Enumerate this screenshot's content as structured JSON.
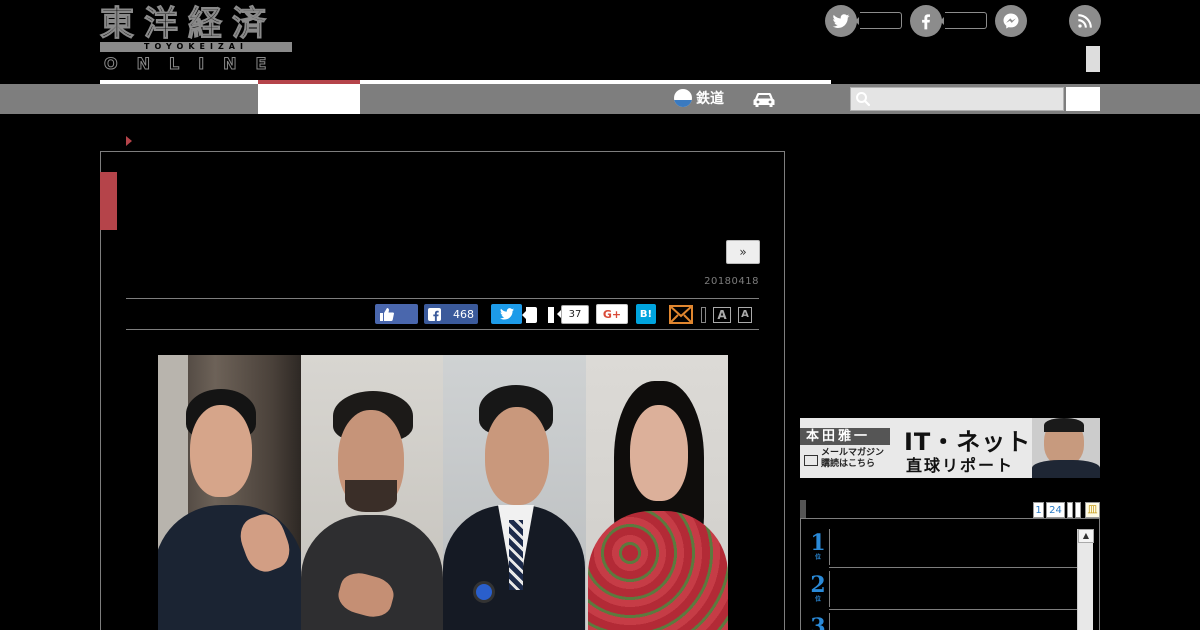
{
  "header": {
    "logo_kanji": "東洋経済",
    "logo_romaji": "TOYOKEIZAI",
    "logo_online": "ONLINE"
  },
  "nav": {
    "rail_label": "鉄道"
  },
  "article": {
    "next_label": "»",
    "date": "20180418"
  },
  "share": {
    "facebook_count": "468",
    "pocket_count": "37",
    "googleplus_label": "G+",
    "hatena_label": "B!",
    "font_large_label": "A",
    "font_small_label": "A"
  },
  "sidebar": {
    "banner_name": "本田雅一",
    "banner_sub_line1": "メールマガジン",
    "banner_sub_line2": "購読はこちら",
    "banner_title": "IT・ネット",
    "banner_subtitle": "直球リポート",
    "ranking_tabs": [
      "1",
      "24"
    ],
    "ranking_tab_extra": "皿",
    "ranking_numbers": [
      "1",
      "2",
      "3"
    ],
    "ranking_suffix": "位"
  },
  "colors": {
    "accent_red": "#b5444a",
    "nav_gray": "#7e7e7e",
    "rank_blue": "#2a8ad8"
  }
}
